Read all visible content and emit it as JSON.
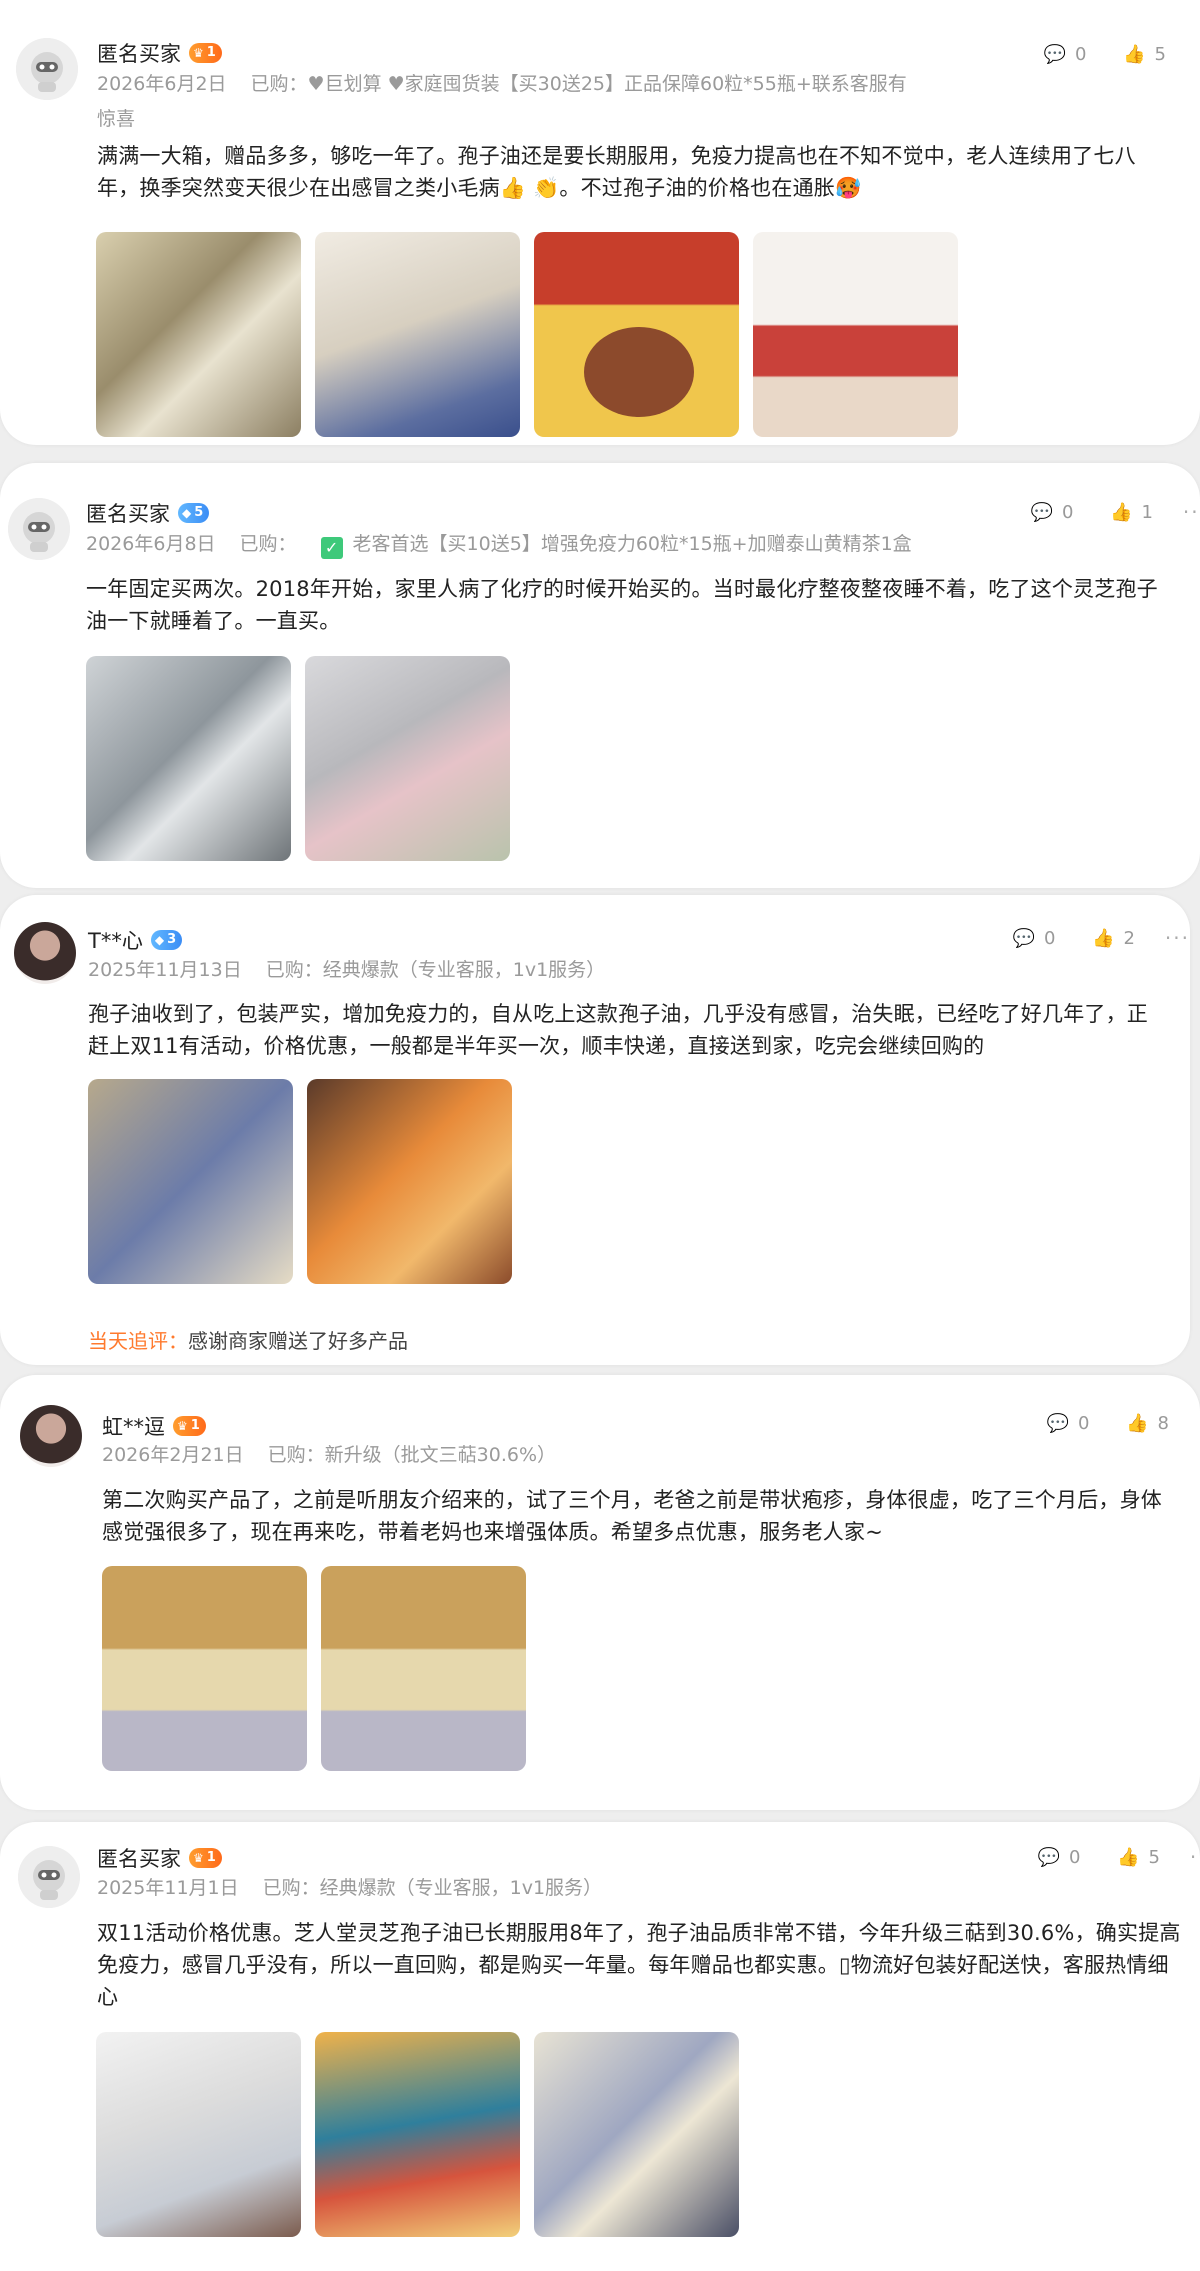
{
  "reviews": [
    {
      "user": "匿名买家",
      "level": "1",
      "level_color": "gold",
      "date": "2026年6月2日",
      "purchased_label": "已购：",
      "purchased_line1": "♥巨划算 ♥家庭囤货装【买30送25】正品保障60粒*55瓶+联系客服有",
      "purchased_line2": "惊喜",
      "comments": "0",
      "likes": "5",
      "text": "满满一大箱，赠品多多，够吃一年了。孢子油还是要长期服用，免疫力提高也在不知不觉中，老人连续用了七八年，换季突然变天很少在出感冒之类小毛病👍 👏。不过孢子油的价格也在通胀🥵"
    },
    {
      "user": "匿名买家",
      "level": "5",
      "level_color": "blue",
      "date": "2026年6月8日",
      "purchased_label": "已购：",
      "purchased": "老客首选【买10送5】增强免疫力60粒*15瓶+加赠泰山黄精茶1盒",
      "comments": "0",
      "likes": "1",
      "text": "一年固定买两次。2018年开始，家里人病了化疗的时候开始买的。当时最化疗整夜整夜睡不着，吃了这个灵芝孢子油一下就睡着了。一直买。"
    },
    {
      "user": "T**心",
      "level": "3",
      "level_color": "blue",
      "date": "2025年11月13日",
      "purchased_label": "已购：",
      "purchased": "经典爆款（专业客服，1v1服务）",
      "comments": "0",
      "likes": "2",
      "text": "孢子油收到了，包装严实，增加免疫力的，自从吃上这款孢子油，几乎没有感冒，治失眠，已经吃了好几年了，正赶上双11有活动，价格优惠，一般都是半年买一次，顺丰快递，直接送到家，吃完会继续回购的",
      "followup_label": "当天追评：",
      "followup_text": "感谢商家赠送了好多产品"
    },
    {
      "user": "虹**逗",
      "level": "1",
      "level_color": "gold",
      "date": "2026年2月21日",
      "purchased_label": "已购：",
      "purchased": "新升级（批文三萜30.6%）",
      "comments": "0",
      "likes": "8",
      "text": "第二次购买产品了，之前是听朋友介绍来的，试了三个月，老爸之前是带状疱疹，身体很虚，吃了三个月后，身体感觉强很多了，现在再来吃，带着老妈也来增强体质。希望多点优惠，服务老人家~"
    },
    {
      "user": "匿名买家",
      "level": "1",
      "level_color": "gold",
      "date": "2025年11月1日",
      "purchased_label": "已购：",
      "purchased": "经典爆款（专业客服，1v1服务）",
      "comments": "0",
      "likes": "5",
      "text": "双11活动价格优惠。芝人堂灵芝孢子油已长期服用8年了，孢子油品质非常不错，今年升级三萜到30.6%，确实提高免疫力，感冒几乎没有，所以一直回购，都是购买一年量。每年赠品也都实惠。▯物流好包装好配送快，客服热情细心"
    }
  ]
}
